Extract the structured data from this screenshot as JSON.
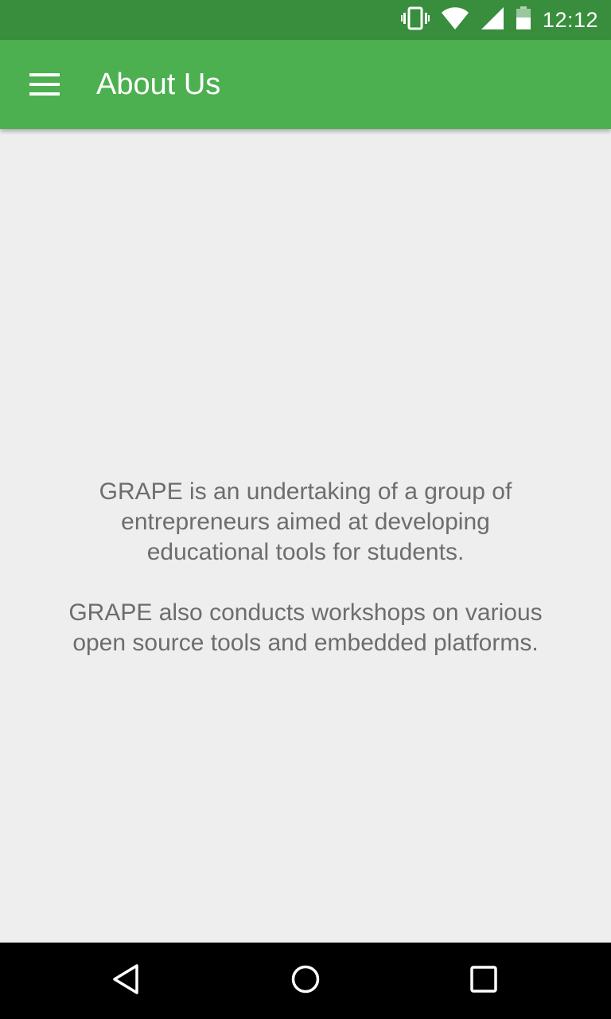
{
  "status_bar": {
    "time": "12:12",
    "icons": [
      "vibrate-icon",
      "wifi-icon",
      "signal-icon",
      "battery-icon"
    ]
  },
  "app_bar": {
    "title": "About Us",
    "menu_icon": "menu-icon",
    "color": "#4caf50"
  },
  "content": {
    "paragraphs": [
      "GRAPE is an undertaking of a group of entrepreneurs aimed at developing educational tools for students.",
      "GRAPE also conducts workshops on various open source tools and embedded platforms."
    ]
  },
  "nav_bar": {
    "buttons": [
      "back-icon",
      "home-icon",
      "recents-icon"
    ]
  },
  "colors": {
    "status_bar": "#388e3c",
    "app_bar": "#4caf50",
    "background": "#eeeeee",
    "body_text": "#6d6d6d"
  }
}
